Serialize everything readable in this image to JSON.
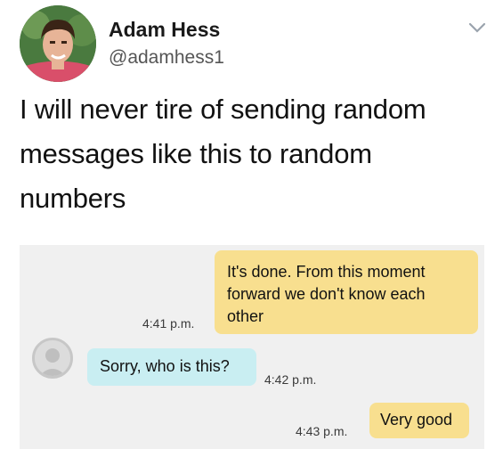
{
  "tweet": {
    "author_name": "Adam Hess",
    "author_handle": "@adamhess1",
    "text_lines": [
      "I will never tire of sending random",
      "messages like this to random",
      "numbers"
    ],
    "menu_icon": "chevron-down-icon"
  },
  "chat": {
    "messages": [
      {
        "direction": "sent",
        "lines": [
          "It's done. From this moment",
          "forward we don't know each",
          "other"
        ],
        "time": "4:41 p.m."
      },
      {
        "direction": "received",
        "lines": [
          "Sorry, who is this?"
        ],
        "time": "4:42 p.m."
      },
      {
        "direction": "sent",
        "lines": [
          "Very good"
        ],
        "time": "4:43 p.m."
      }
    ],
    "colors": {
      "sent_bubble": "#f8df8f",
      "received_bubble": "#c9eef2",
      "background": "#f0f0f0"
    }
  }
}
